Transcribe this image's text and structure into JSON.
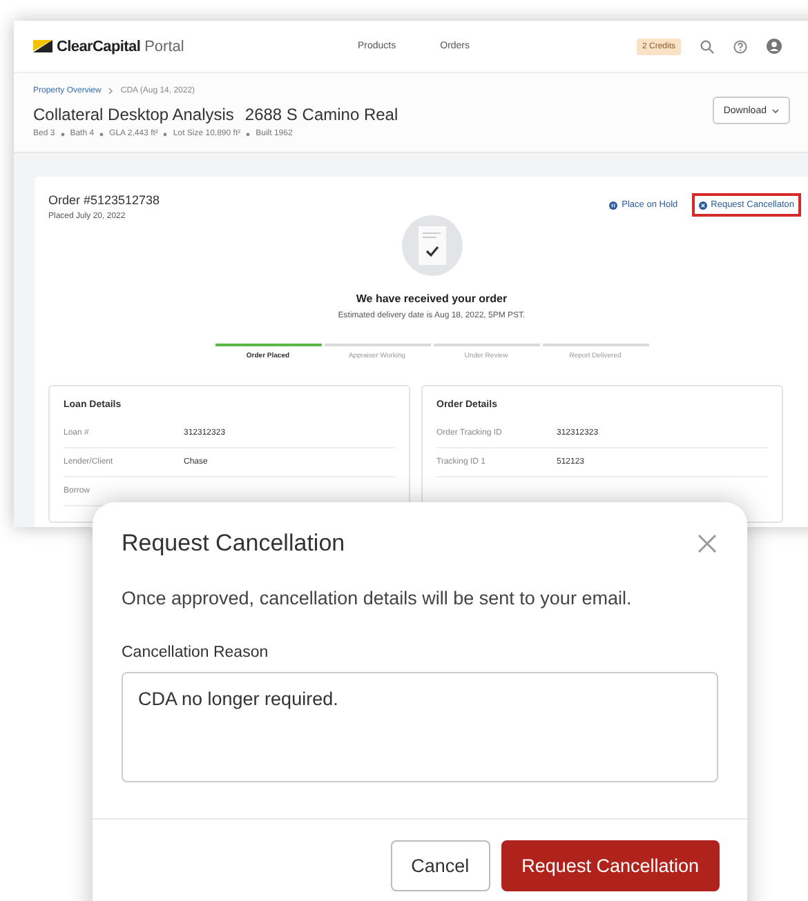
{
  "header": {
    "brand": "ClearCapital",
    "brand_suffix": "Portal",
    "nav": [
      {
        "label": "Products"
      },
      {
        "label": "Orders"
      }
    ],
    "credits": "2 Credits"
  },
  "breadcrumb": [
    {
      "label": "Property Overview",
      "link": true
    },
    {
      "label": "CDA (Aug 14, 2022)",
      "link": false
    }
  ],
  "title": {
    "product": "Collateral Desktop Analysis",
    "address": "2688 S Camino Real"
  },
  "facts": [
    "Bed 3",
    "Bath 4",
    "GLA 2,443 ft²",
    "Lot Size 10,890 ft²",
    "Built 1962"
  ],
  "download": "Download",
  "order": {
    "number": "Order #5123512738",
    "placed": "Placed July 20, 2022",
    "actions": [
      {
        "label": "Place on Hold",
        "highlighted": false
      },
      {
        "label": "Request Cancellaton",
        "highlighted": true
      }
    ],
    "status_title": "We have received your order",
    "status_note": "Estimated delivery date is Aug 18, 2022, 5PM PST.",
    "steps": [
      {
        "label": "Order Placed",
        "done": true
      },
      {
        "label": "Appraiser Working",
        "done": false
      },
      {
        "label": "Under Review",
        "done": false
      },
      {
        "label": "Report Delivered",
        "done": false
      }
    ]
  },
  "panels": [
    {
      "title": "Loan Details",
      "rows": [
        {
          "label": "Loan #",
          "value": "312312323"
        },
        {
          "label": "Lender/Client",
          "value": "Chase"
        },
        {
          "label": "Borrow",
          "value": ""
        }
      ]
    },
    {
      "title": "Order Details",
      "rows": [
        {
          "label": "Order Tracking ID",
          "value": "312312323"
        },
        {
          "label": "Tracking ID 1",
          "value": "512123"
        }
      ]
    }
  ],
  "dialog": {
    "title": "Request Cancellation",
    "message": "Once approved, cancellation details will be sent to your email.",
    "field_label": "Cancellation Reason",
    "field_value": "CDA no longer required.",
    "buttons": [
      {
        "label": "Cancel",
        "kind": "secondary"
      },
      {
        "label": "Request Cancellation",
        "kind": "primary"
      }
    ]
  }
}
